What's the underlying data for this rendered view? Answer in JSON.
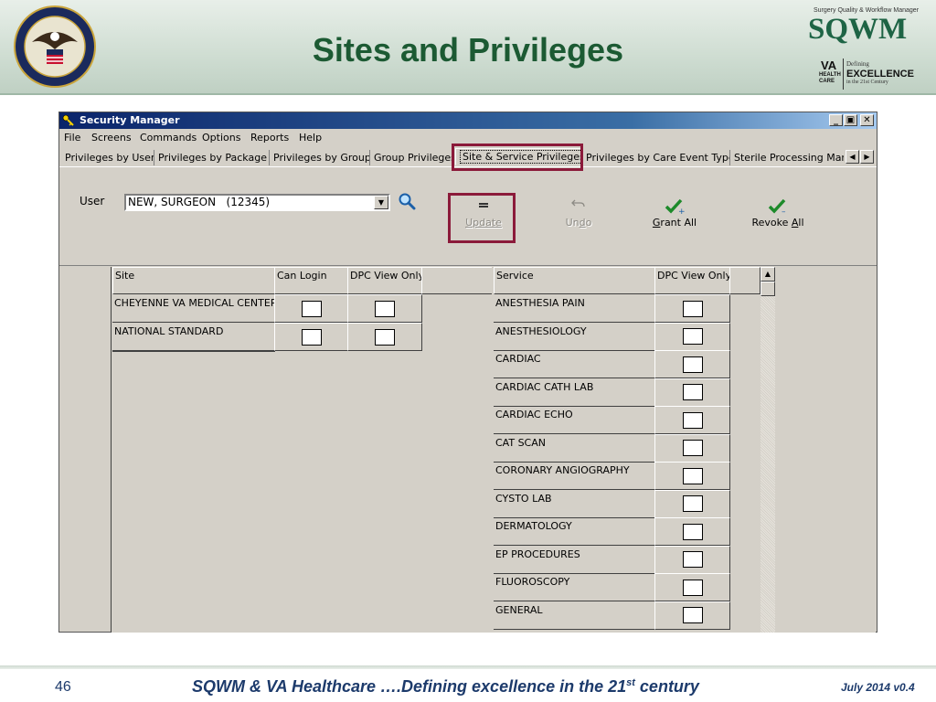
{
  "slide": {
    "title": "Sites and Privileges",
    "page_number": "46",
    "footer_text_main": "SQWM & VA Healthcare ….Defining excellence in the 21",
    "footer_text_sup": "st",
    "footer_text_end": " century",
    "footer_date": "July 2014 v0.4"
  },
  "logo": {
    "tagline": "Surgery Quality & Workflow Manager",
    "name": "SQWM",
    "va": "VA",
    "health": "HEALTH",
    "care": "CARE",
    "defining": "Defining",
    "excellence": "EXCELLENCE",
    "century": "in the 21st Century"
  },
  "window": {
    "title": "Security Manager",
    "controls": {
      "minimize": "_",
      "restore": "▣",
      "close": "✕"
    }
  },
  "menu": [
    "File",
    "Screens",
    "Commands",
    "Options",
    "Reports",
    "Help"
  ],
  "tabs": [
    "Privileges by User",
    "Privileges by Package",
    "Privileges by Group",
    "Group Privileges",
    "Site & Service Privileges",
    "Privileges by Care Event Type",
    "Sterile Processing Mana"
  ],
  "active_tab_index": 4,
  "user": {
    "label": "User",
    "value": "NEW, SURGEON   (12345)"
  },
  "toolbar": {
    "update": "Update",
    "undo": "Undo",
    "grant_all": "Grant All",
    "revoke_all": "Revoke All"
  },
  "sites_table": {
    "columns": [
      "Site",
      "Can Login",
      "DPC View Only"
    ],
    "rows": [
      {
        "site": "CHEYENNE VA MEDICAL CENTER",
        "can_login": false,
        "dpc_view_only": false
      },
      {
        "site": "NATIONAL STANDARD",
        "can_login": false,
        "dpc_view_only": false
      }
    ]
  },
  "services_table": {
    "columns": [
      "Service",
      "DPC View Only"
    ],
    "rows": [
      "ANESTHESIA PAIN",
      "ANESTHESIOLOGY",
      "CARDIAC",
      "CARDIAC CATH LAB",
      "CARDIAC ECHO",
      "CAT SCAN",
      "CORONARY ANGIOGRAPHY",
      "CYSTO LAB",
      "DERMATOLOGY",
      "EP PROCEDURES",
      "FLUOROSCOPY",
      "GENERAL"
    ]
  },
  "colors": {
    "title_green": "#1c5a33",
    "highlight": "#8b1a3a",
    "footer_blue": "#1c3a6b",
    "titlebar": "#0a246a"
  }
}
